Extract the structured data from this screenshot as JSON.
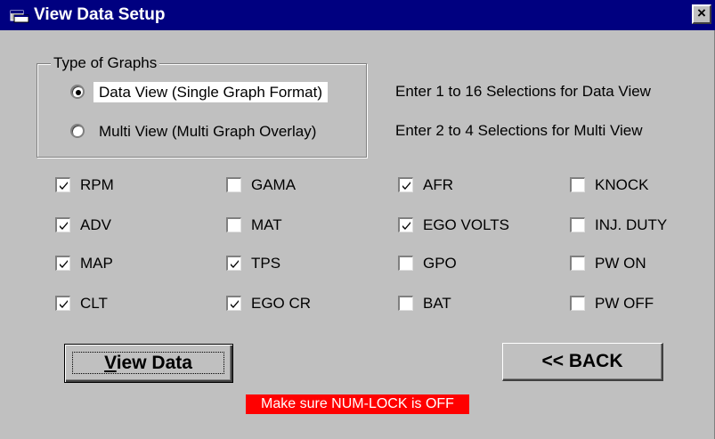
{
  "window": {
    "title": "View Data Setup",
    "close_glyph": "×",
    "title_icon": "app-window-icon",
    "titlebar_color": "#000080"
  },
  "graph_type": {
    "legend": "Type of Graphs",
    "options": [
      {
        "label": "Data View (Single Graph Format)",
        "selected": true
      },
      {
        "label": "Multi View (Multi Graph Overlay)",
        "selected": false
      }
    ]
  },
  "hints": {
    "data_view": "Enter 1 to 16 Selections for Data View",
    "multi_view": "Enter 2 to 4 Selections for Multi View"
  },
  "selections": [
    [
      {
        "label": "RPM",
        "checked": true
      },
      {
        "label": "ADV",
        "checked": true
      },
      {
        "label": "MAP",
        "checked": true
      },
      {
        "label": "CLT",
        "checked": true
      }
    ],
    [
      {
        "label": "GAMA",
        "checked": false
      },
      {
        "label": "MAT",
        "checked": false
      },
      {
        "label": "TPS",
        "checked": true
      },
      {
        "label": "EGO CR",
        "checked": true
      }
    ],
    [
      {
        "label": "AFR",
        "checked": true
      },
      {
        "label": "EGO VOLTS",
        "checked": true
      },
      {
        "label": "GPO",
        "checked": false
      },
      {
        "label": "BAT",
        "checked": false
      }
    ],
    [
      {
        "label": "KNOCK",
        "checked": false
      },
      {
        "label": "INJ. DUTY",
        "checked": false
      },
      {
        "label": "PW ON",
        "checked": false
      },
      {
        "label": "PW OFF",
        "checked": false
      }
    ]
  ],
  "buttons": {
    "view_data_label": "View Data",
    "view_data_underline": "V",
    "back_label": "<< BACK"
  },
  "warning": {
    "text": "Make sure NUM-LOCK is OFF",
    "background": "#ff0000"
  }
}
